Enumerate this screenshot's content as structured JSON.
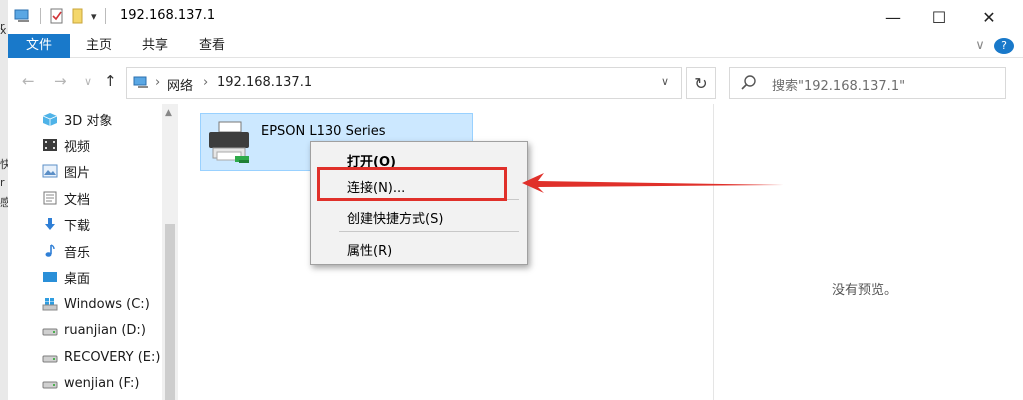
{
  "titlebar": {
    "title": "192.168.137.1",
    "minimize": "—",
    "maximize": "☐",
    "close": "✕",
    "qat_dropdown": "▾"
  },
  "ribbon": {
    "tabs": [
      "文件",
      "主页",
      "共享",
      "查看"
    ],
    "collapse": "∨",
    "help": "?"
  },
  "address": {
    "crumbs": [
      "网络",
      "192.168.137.1"
    ],
    "sep": "›",
    "dropdown": "∨",
    "refresh": "↻",
    "search_placeholder": "搜索\"192.168.137.1\""
  },
  "nav": {
    "back": "←",
    "forward": "→",
    "recent": "∨",
    "up": "↑",
    "items": [
      {
        "label": "3D 对象",
        "icon": "3d-objects-icon"
      },
      {
        "label": "视频",
        "icon": "video-icon"
      },
      {
        "label": "图片",
        "icon": "pictures-icon"
      },
      {
        "label": "文档",
        "icon": "documents-icon"
      },
      {
        "label": "下载",
        "icon": "download-icon"
      },
      {
        "label": "音乐",
        "icon": "music-icon"
      },
      {
        "label": "桌面",
        "icon": "desktop-icon"
      },
      {
        "label": "Windows (C:)",
        "icon": "windows-drive-icon"
      },
      {
        "label": "ruanjian (D:)",
        "icon": "drive-icon"
      },
      {
        "label": "RECOVERY (E:)",
        "icon": "drive-icon"
      },
      {
        "label": "wenjian (F:)",
        "icon": "drive-icon"
      }
    ]
  },
  "content": {
    "printer_name": "EPSON L130 Series",
    "preview_text": "没有预览。"
  },
  "context_menu": {
    "items": [
      "打开(O)",
      "连接(N)...",
      "创建快捷方式(S)",
      "属性(R)"
    ]
  },
  "left_strip": [
    "r",
    "x",
    "快",
    "r",
    "感"
  ],
  "colors": {
    "accent": "#1979ca",
    "selection": "#cce8ff",
    "highlight": "#e0302a"
  }
}
